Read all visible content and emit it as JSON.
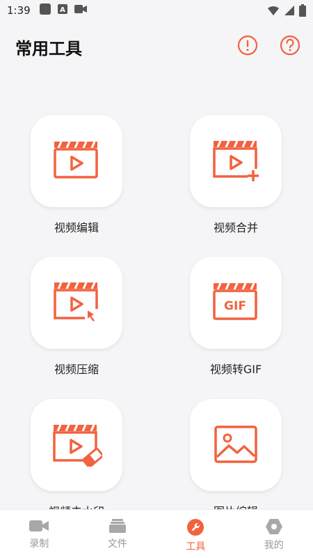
{
  "status_bar": {
    "time": "1:39",
    "icons": [
      "square-notification-icon",
      "a-notification-icon",
      "video-record-notification-icon",
      "wifi-icon",
      "cellular-icon",
      "battery-icon"
    ]
  },
  "header": {
    "title": "常用工具",
    "actions": [
      {
        "icon": "alert-circle-icon"
      },
      {
        "icon": "help-circle-icon"
      }
    ]
  },
  "tools": [
    {
      "label": "视频编辑",
      "icon": "video-edit-icon"
    },
    {
      "label": "视频合并",
      "icon": "video-merge-icon"
    },
    {
      "label": "视频压缩",
      "icon": "video-compress-icon"
    },
    {
      "label": "视频转GIF",
      "icon": "gif-icon",
      "icon_text": "GIF"
    },
    {
      "label": "视频去水印",
      "icon": "video-watermark-remove-icon"
    },
    {
      "label": "图片编辑",
      "icon": "image-edit-icon"
    }
  ],
  "bottom_nav": [
    {
      "label": "录制",
      "icon": "camera-icon",
      "active": false
    },
    {
      "label": "文件",
      "icon": "folder-stack-icon",
      "active": false
    },
    {
      "label": "工具",
      "icon": "wrench-icon",
      "active": true
    },
    {
      "label": "我的",
      "icon": "hexagon-user-icon",
      "active": false
    }
  ],
  "colors": {
    "accent": "#f2623f",
    "background": "#f5f5f7",
    "inactive": "#999999"
  }
}
